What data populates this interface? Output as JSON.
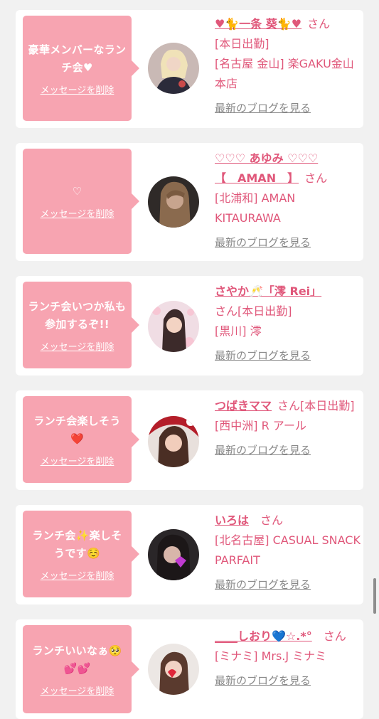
{
  "delete_label": "メッセージを削除",
  "blog_label": "最新のブログを見る",
  "san_label": "さん",
  "colors": {
    "accent_pink": "#f7a4b1",
    "name_pink": "#e0577a",
    "link_gray": "#888888",
    "background": "#f1f1f1"
  },
  "messages": [
    {
      "text": "豪華メンバーなランチ会♥",
      "name": "♥🐈一条 葵🐈♥",
      "name_line2": "",
      "san_inline": "さん",
      "meta1": "[本日出勤]",
      "meta2": "[名古屋 金山] 楽GAKU金山本店",
      "avatar_icon": "person-photo"
    },
    {
      "text": "♡",
      "name": "♡♡♡ あゆみ ♡♡♡",
      "name_line2": "【　AMAN　】",
      "san_inline": "さん",
      "meta1": "",
      "meta2": "[北浦和] AMAN KITAURAWA",
      "avatar_icon": "person-photo"
    },
    {
      "text": "ランチ会いつか私も参加するぞ!!",
      "name": "さやか🥂「澪 Rei」",
      "name_line2": "",
      "san_inline": "さん[本日出勤]",
      "meta1": "",
      "meta2": "[黒川] 澪",
      "avatar_icon": "person-photo"
    },
    {
      "text": "ランチ会楽しそう❤️",
      "name": "つばきママ",
      "name_line2": "",
      "san_inline": "さん[本日出勤]",
      "meta1": "",
      "meta2": "[西中洲] R アール",
      "avatar_icon": "person-photo"
    },
    {
      "text": "ランチ会✨楽しそうです☺️",
      "name": "いろは",
      "name_line2": "",
      "san_inline": "さん",
      "meta1": "",
      "meta2": "[北名古屋] CASUAL SNACK PARFAIT",
      "avatar_icon": "person-photo"
    },
    {
      "text": "ランチいいなぁ🥺💕💕",
      "name": "____しおり💙☆.*°",
      "name_line2": "",
      "san_inline": "さん",
      "meta1": "",
      "meta2": "[ミナミ] Mrs.J ミナミ",
      "avatar_icon": "person-photo"
    }
  ]
}
